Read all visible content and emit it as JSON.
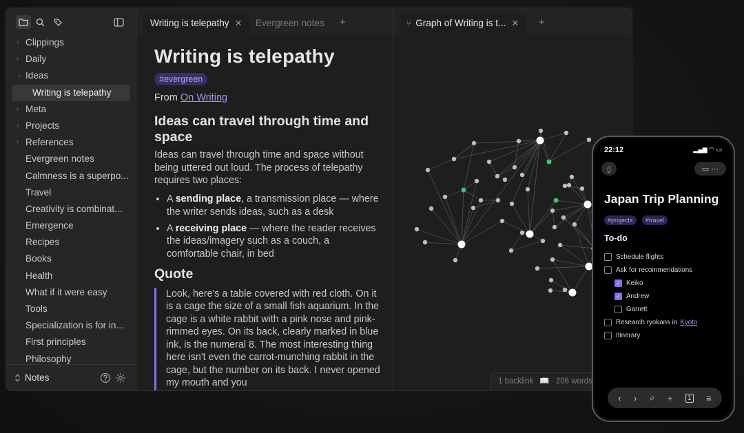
{
  "sidebar": {
    "items": [
      {
        "label": "Clippings",
        "chevron": "›"
      },
      {
        "label": "Daily",
        "chevron": "›"
      },
      {
        "label": "Ideas",
        "chevron": "⌄"
      },
      {
        "label": "Writing is telepathy",
        "chevron": ""
      },
      {
        "label": "Meta",
        "chevron": "›"
      },
      {
        "label": "Projects",
        "chevron": "›"
      },
      {
        "label": "References",
        "chevron": "›"
      },
      {
        "label": "Evergreen notes",
        "chevron": ""
      },
      {
        "label": "Calmness is a superpo...",
        "chevron": ""
      },
      {
        "label": "Travel",
        "chevron": ""
      },
      {
        "label": "Creativity is combinat...",
        "chevron": ""
      },
      {
        "label": "Emergence",
        "chevron": ""
      },
      {
        "label": "Recipes",
        "chevron": ""
      },
      {
        "label": "Books",
        "chevron": ""
      },
      {
        "label": "Health",
        "chevron": ""
      },
      {
        "label": "What if it were easy",
        "chevron": ""
      },
      {
        "label": "Tools",
        "chevron": ""
      },
      {
        "label": "Specialization is for in...",
        "chevron": ""
      },
      {
        "label": "First principles",
        "chevron": ""
      },
      {
        "label": "Philosophy",
        "chevron": ""
      }
    ],
    "vault_name": "Notes"
  },
  "left_tabs": {
    "active": "Writing is telepathy",
    "inactive": "Evergreen notes"
  },
  "right_tab": {
    "label": "Graph of Writing is t..."
  },
  "note": {
    "title": "Writing is telepathy",
    "tag": "#evergreen",
    "from_prefix": "From",
    "from_link": "On Writing",
    "h2": "Ideas can travel through time and space",
    "intro": "Ideas can travel through time and space without being uttered out loud. The process of telepathy requires two places:",
    "bullet1_pre": "A",
    "bullet1_bold": "sending place",
    "bullet1_post": ", a transmission place — where the writer sends ideas, such as a desk",
    "bullet2_pre": "A",
    "bullet2_bold": "receiving place",
    "bullet2_post": " — where the reader receives the ideas/imagery such as a couch, a comfortable chair, in bed",
    "h3": "Quote",
    "quote": "Look, here's a table covered with red cloth. On it is a cage the size of a small fish aquarium. In the cage is a white rabbit with a pink nose and pink-rimmed eyes. On its back, clearly marked in blue ink, is the numeral 8. The most interesting thing here isn't even the carrot-munching rabbit in the cage, but the number on its back. I never opened my mouth and you"
  },
  "status": {
    "backlinks": "1 backlink",
    "words": "206 words"
  },
  "phone": {
    "time": "22:12",
    "title": "Japan Trip Planning",
    "tags": [
      "#projects",
      "#travel"
    ],
    "heading": "To-do",
    "todos": [
      {
        "text": "Schedule flights",
        "checked": false,
        "sub": false
      },
      {
        "text": "Ask for recommendations",
        "checked": false,
        "sub": false
      },
      {
        "text": "Keiko",
        "checked": true,
        "sub": true
      },
      {
        "text": "Andrew",
        "checked": true,
        "sub": true
      },
      {
        "text": "Garrett",
        "checked": false,
        "sub": true
      },
      {
        "text": "Research ryokans in",
        "checked": false,
        "sub": false,
        "link": "Kyoto"
      },
      {
        "text": "Itinerary",
        "checked": false,
        "sub": false
      }
    ]
  },
  "colors": {
    "accent": "#8b6cf0",
    "graph_highlight": "#3ec46d",
    "node": "#bdbdbd"
  }
}
